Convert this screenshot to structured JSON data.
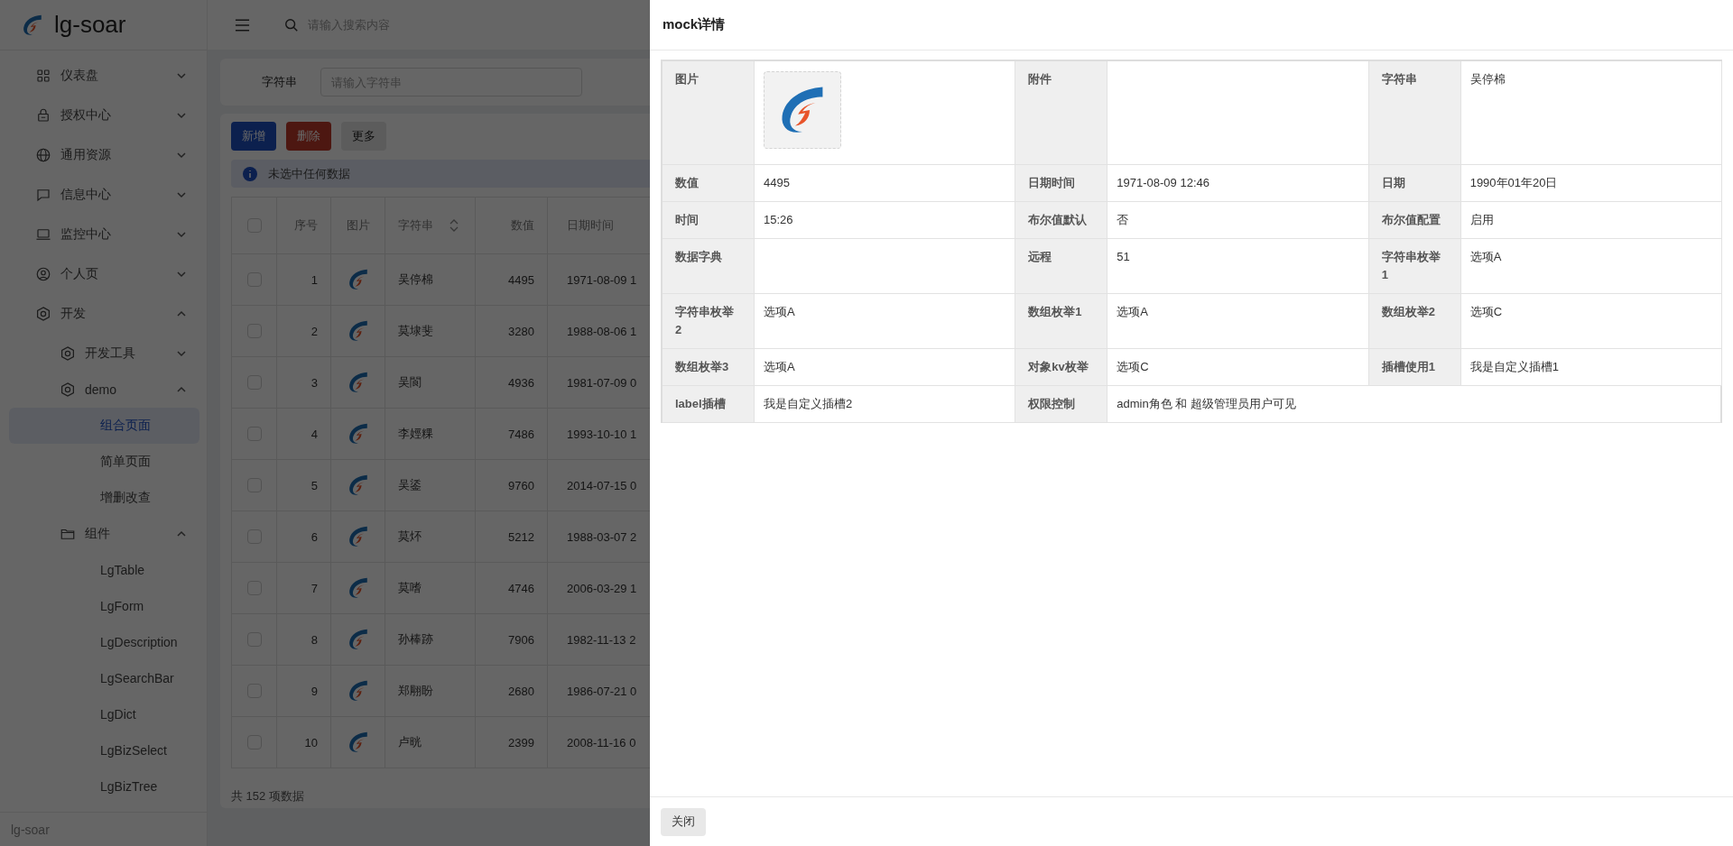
{
  "app": {
    "name": "lg-soar",
    "footer": "lg-soar"
  },
  "sidebar": {
    "items": [
      {
        "label": "仪表盘",
        "expanded": false
      },
      {
        "label": "授权中心",
        "expanded": false
      },
      {
        "label": "通用资源",
        "expanded": false
      },
      {
        "label": "信息中心",
        "expanded": false
      },
      {
        "label": "监控中心",
        "expanded": false
      },
      {
        "label": "个人页",
        "expanded": false
      },
      {
        "label": "开发",
        "expanded": true,
        "children": [
          {
            "label": "开发工具",
            "expanded": false
          },
          {
            "label": "demo",
            "expanded": true,
            "children": [
              {
                "label": "组合页面",
                "selected": true
              },
              {
                "label": "简单页面",
                "selected": false
              },
              {
                "label": "增删改查",
                "selected": false
              }
            ]
          },
          {
            "label": "组件",
            "expanded": true,
            "children": [
              {
                "label": "LgTable",
                "selected": false
              },
              {
                "label": "LgForm",
                "selected": false
              },
              {
                "label": "LgDescription",
                "selected": false
              },
              {
                "label": "LgSearchBar",
                "selected": false
              },
              {
                "label": "LgDict",
                "selected": false
              },
              {
                "label": "LgBizSelect",
                "selected": false
              },
              {
                "label": "LgBizTree",
                "selected": false
              }
            ]
          }
        ]
      }
    ]
  },
  "header": {
    "search": {
      "placeholder": "请输入搜索内容"
    }
  },
  "search_form": {
    "fields": [
      {
        "label": "字符串",
        "placeholder": "请输入字符串"
      }
    ]
  },
  "toolbar": {
    "buttons": [
      {
        "label": "新增",
        "kind": "primary"
      },
      {
        "label": "删除",
        "kind": "danger"
      },
      {
        "label": "更多",
        "kind": "default"
      }
    ]
  },
  "alert": {
    "text": "未选中任何数据"
  },
  "table": {
    "select_all_checked": false,
    "columns": [
      {
        "label": "序号",
        "sortable": false
      },
      {
        "label": "图片",
        "sortable": false
      },
      {
        "label": "字符串",
        "sortable": true
      },
      {
        "label": "数值",
        "sortable": false
      },
      {
        "label": "日期时间",
        "sortable": false
      }
    ],
    "rows": [
      {
        "checked": false,
        "index": "1",
        "name": "吴停棉",
        "number": "4495",
        "datetime": "1971-08-09 1"
      },
      {
        "checked": false,
        "index": "2",
        "name": "莫埭斐",
        "number": "3280",
        "datetime": "1988-08-06 1"
      },
      {
        "checked": false,
        "index": "3",
        "name": "吴閬",
        "number": "4936",
        "datetime": "1981-07-09 0"
      },
      {
        "checked": false,
        "index": "4",
        "name": "李娙粿",
        "number": "7486",
        "datetime": "1993-10-10 1"
      },
      {
        "checked": false,
        "index": "5",
        "name": "吴鋈",
        "number": "9760",
        "datetime": "2014-07-15 0"
      },
      {
        "checked": false,
        "index": "6",
        "name": "莫炋",
        "number": "5212",
        "datetime": "1988-03-07 2"
      },
      {
        "checked": false,
        "index": "7",
        "name": "莫嗜",
        "number": "4746",
        "datetime": "2006-03-29 1"
      },
      {
        "checked": false,
        "index": "8",
        "name": "孙棒跡",
        "number": "7906",
        "datetime": "1982-11-13 2"
      },
      {
        "checked": false,
        "index": "9",
        "name": "郑翢盼",
        "number": "2680",
        "datetime": "1986-07-21 0"
      },
      {
        "checked": false,
        "index": "10",
        "name": "卢晄",
        "number": "2399",
        "datetime": "2008-11-16 0"
      }
    ],
    "footer": "共 152 项数据"
  },
  "drawer": {
    "title": "mock详情",
    "items": [
      {
        "kind": "image",
        "label": "图片"
      },
      {
        "kind": "text",
        "label": "附件"
      },
      {
        "kind": "text",
        "label": "字符串",
        "value": "吴停棉"
      },
      {
        "kind": "text",
        "label": "数值",
        "value": "4495"
      },
      {
        "kind": "text",
        "label": "日期时间",
        "value": "1971-08-09 12:46"
      },
      {
        "kind": "text",
        "label": "日期",
        "value": "1990年01年20日"
      },
      {
        "kind": "text",
        "label": "时间",
        "value": "15:26"
      },
      {
        "kind": "text",
        "label": "布尔值默认",
        "value": "否"
      },
      {
        "kind": "text",
        "label": "布尔值配置",
        "value": "启用"
      },
      {
        "kind": "text",
        "label": "数据字典"
      },
      {
        "kind": "text",
        "label": "远程",
        "value": "51"
      },
      {
        "kind": "text",
        "label": "字符串枚举1",
        "value": "选项A"
      },
      {
        "kind": "text",
        "label": "字符串枚举2",
        "value": "选项A"
      },
      {
        "kind": "text",
        "label": "数组枚举1",
        "value": "选项A"
      },
      {
        "kind": "text",
        "label": "数组枚举2",
        "value": "选项C"
      },
      {
        "kind": "text",
        "label": "数组枚举3",
        "value": "选项A"
      },
      {
        "kind": "text",
        "label": "对象kv枚举",
        "value": "选项C"
      },
      {
        "kind": "text",
        "label": "插槽使用1",
        "value": "我是自定义插槽1"
      },
      {
        "kind": "text",
        "label": "label插槽",
        "value": "我是自定义插槽2"
      },
      {
        "kind": "text",
        "label": "权限控制",
        "value": "admin角色 和 超级管理员用户可见"
      }
    ],
    "buttons": [
      {
        "label": "关闭"
      }
    ]
  }
}
